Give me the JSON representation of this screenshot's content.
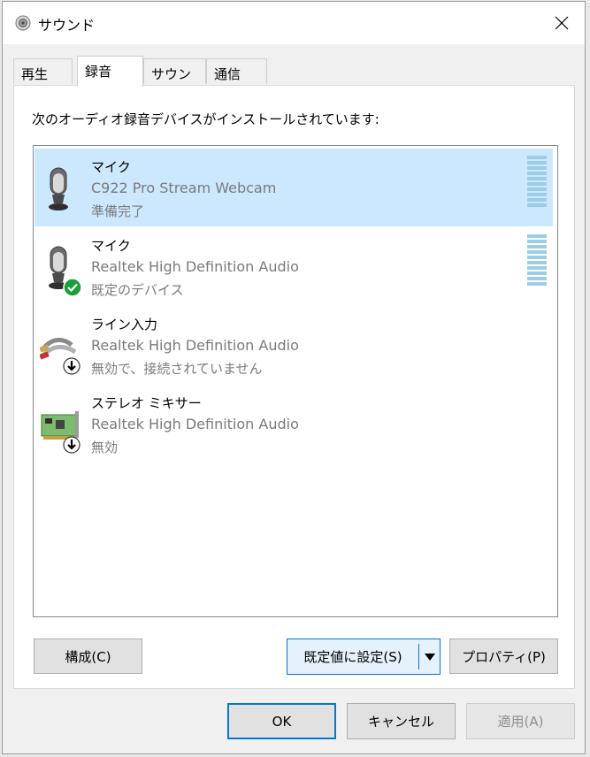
{
  "window": {
    "title": "サウンド",
    "close_glyph": "✕"
  },
  "tabs": [
    {
      "label": "再生",
      "active": false
    },
    {
      "label": "録音",
      "active": true
    },
    {
      "label": "サウンド",
      "active": false
    },
    {
      "label": "通信",
      "active": false
    }
  ],
  "panel": {
    "instruction": "次のオーディオ録音デバイスがインストールされています:",
    "devices": [
      {
        "name": "マイク",
        "description": "C922 Pro Stream Webcam",
        "status": "準備完了",
        "icon": "microphone-icon",
        "badge": "",
        "selected": true,
        "level_meter": true
      },
      {
        "name": "マイク",
        "description": "Realtek High Definition Audio",
        "status": "既定のデバイス",
        "icon": "microphone-icon",
        "badge": "default-check-icon",
        "selected": false,
        "level_meter": true
      },
      {
        "name": "ライン入力",
        "description": "Realtek High Definition Audio",
        "status": "無効で、接続されていません",
        "icon": "line-in-cable-icon",
        "badge": "down-arrow-icon",
        "selected": false,
        "level_meter": false
      },
      {
        "name": "ステレオ ミキサー",
        "description": "Realtek High Definition Audio",
        "status": "無効",
        "icon": "sound-card-icon",
        "badge": "down-arrow-icon",
        "selected": false,
        "level_meter": false
      }
    ],
    "buttons": {
      "configure": "構成(C)",
      "set_default": "既定値に設定(S)",
      "properties": "プロパティ(P)"
    }
  },
  "footer": {
    "ok": "OK",
    "cancel": "キャンセル",
    "apply": "適用(A)"
  },
  "colors": {
    "selection": "#cce8ff",
    "accent": "#0078d7",
    "meter": "#9ccde6",
    "check": "#1a9e3a"
  }
}
